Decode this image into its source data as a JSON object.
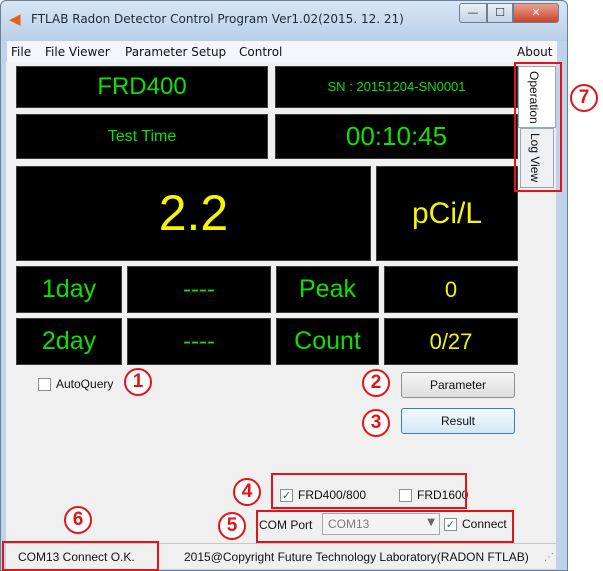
{
  "window": {
    "title": "FTLAB Radon Detector Control Program Ver1.02(2015. 12. 21)",
    "controls": {
      "minimize": "—",
      "maximize": "☐",
      "close": "✕"
    }
  },
  "menu": [
    "File",
    "File Viewer",
    "Parameter Setup",
    "Control",
    "About"
  ],
  "tabs": [
    "Operation",
    "Log View"
  ],
  "display": {
    "model": "FRD400",
    "serial": "SN : 20151204-SN0001",
    "test_time_label": "Test Time",
    "test_time": "00:10:45",
    "reading": "2.2",
    "unit": "pCi/L",
    "day1_label": "1day",
    "day1_value": "----",
    "peak_label": "Peak",
    "peak_value": "0",
    "day2_label": "2day",
    "day2_value": "----",
    "count_label": "Count",
    "count_value": "0/27"
  },
  "controls": {
    "auto_query": "AutoQuery",
    "parameter_button": "Parameter",
    "result_button": "Result",
    "frd400_800": "FRD400/800",
    "frd1600": "FRD1600",
    "com_port_label": "COM Port",
    "com_port_value": "COM13",
    "connect": "Connect"
  },
  "status": {
    "connection": "COM13 Connect O.K.",
    "copyright": "2015@Copyright Future Technology Laboratory(RADON FTLAB)"
  },
  "callouts": [
    "1",
    "2",
    "3",
    "4",
    "5",
    "6",
    "7"
  ],
  "colors": {
    "display_bg": "#000000",
    "lcd_green": "#0ee000",
    "reading_yellow": "#f5f500",
    "callout_red": "#e2141a"
  }
}
